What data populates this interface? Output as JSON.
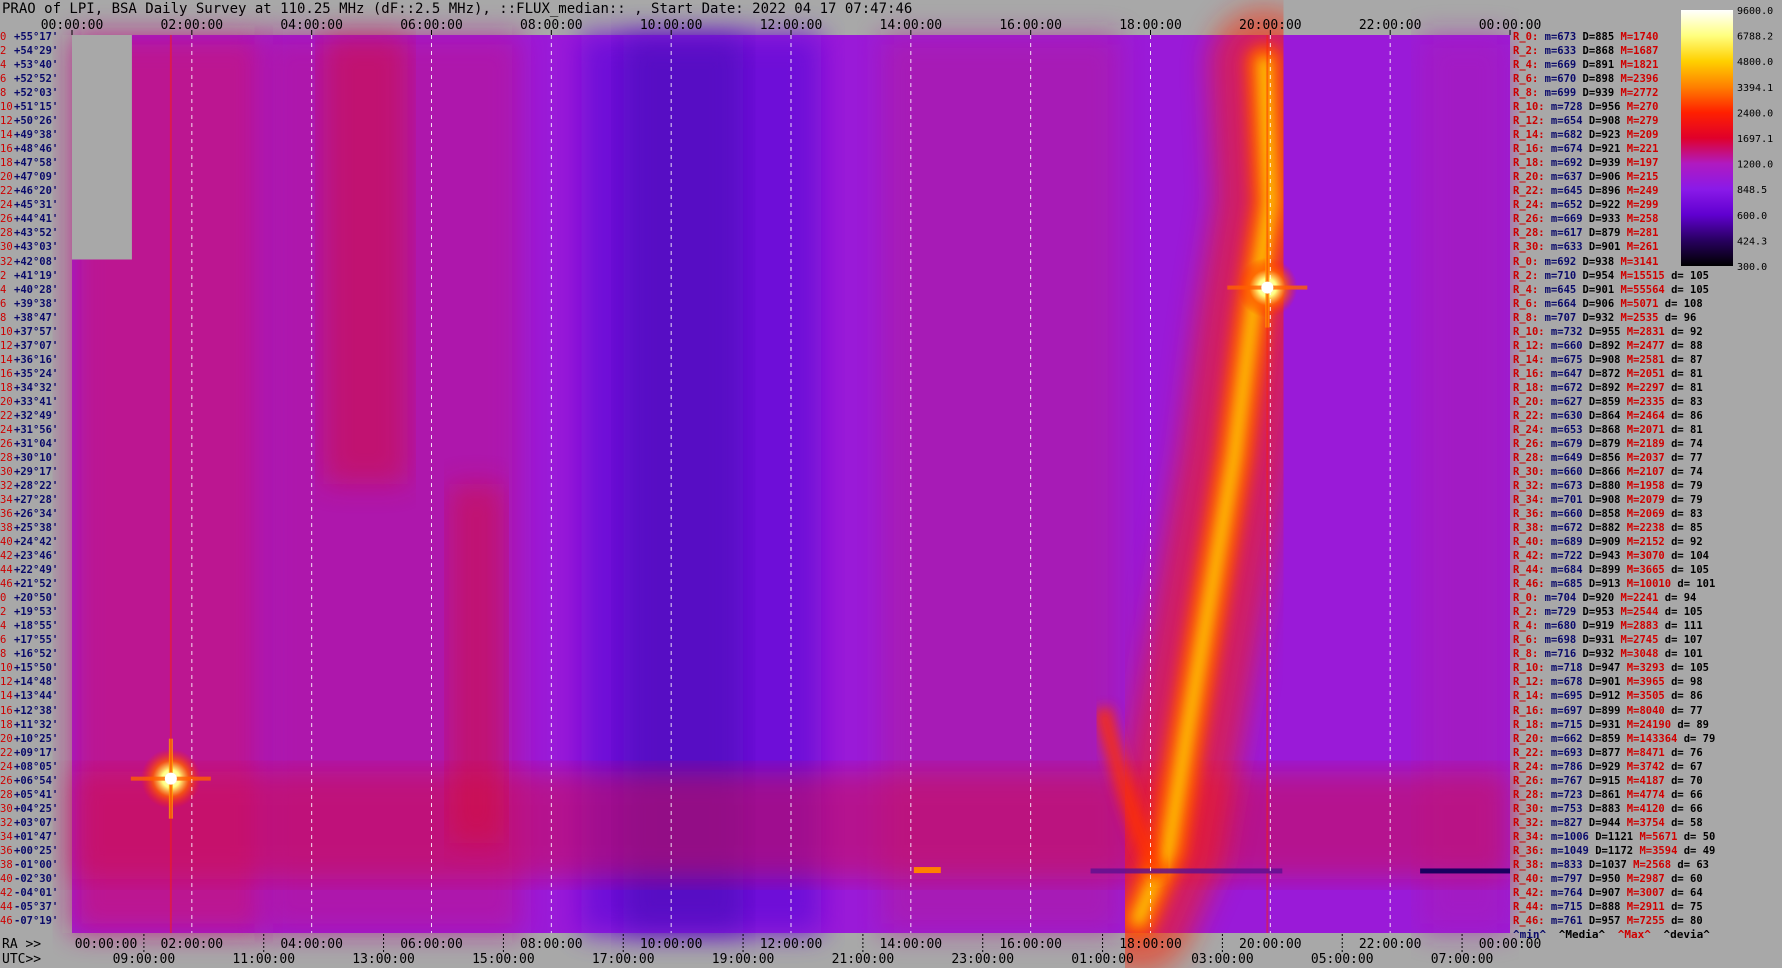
{
  "title": "PRAO of LPI, BSA Daily Survey at 110.25 MHz (dF::2.5 MHz), ::FLUX_median:: , Start Date: 2022 04 17 07:47:46",
  "chart_data": {
    "type": "heatmap",
    "title": "PRAO of LPI, BSA Daily Survey at 110.25 MHz (dF::2.5 MHz), ::FLUX_median:: , Start Date: 2022 04 17 07:47:46",
    "top_time_ticks": [
      "00:00:00",
      "02:00:00",
      "04:00:00",
      "06:00:00",
      "08:00:00",
      "10:00:00",
      "12:00:00",
      "14:00:00",
      "16:00:00",
      "18:00:00",
      "20:00:00",
      "22:00:00",
      "00:00:00"
    ],
    "ra_prefix": "RA >>",
    "ra_ticks": [
      "00:00:00",
      "02:00:00",
      "04:00:00",
      "06:00:00",
      "08:00:00",
      "10:00:00",
      "12:00:00",
      "14:00:00",
      "16:00:00",
      "18:00:00",
      "20:00:00",
      "22:00:00",
      "00:00:00"
    ],
    "utc_prefix": "UTC>>",
    "utc_ticks": [
      "09:00:00",
      "11:00:00",
      "13:00:00",
      "15:00:00",
      "17:00:00",
      "19:00:00",
      "21:00:00",
      "23:00:00",
      "01:00:00",
      "03:00:00",
      "05:00:00",
      "07:00:00"
    ],
    "colorbar": {
      "labels": [
        "9600.0",
        "6788.2",
        "4800.0",
        "3394.1",
        "2400.0",
        "1697.1",
        "1200.0",
        "848.5",
        "600.0",
        "424.3",
        "300.0"
      ],
      "colors": [
        "#ffffff",
        "#ffff80",
        "#ffd000",
        "#ff8000",
        "#ff2000",
        "#e0002a",
        "#b01ac0",
        "#8a1ae8",
        "#6000d0",
        "#280060",
        "#000000"
      ]
    },
    "declinations": [
      {
        "idx": "0",
        "dec": "+55°17'"
      },
      {
        "idx": "2",
        "dec": "+54°29'"
      },
      {
        "idx": "4",
        "dec": "+53°40'"
      },
      {
        "idx": "6",
        "dec": "+52°52'"
      },
      {
        "idx": "8",
        "dec": "+52°03'"
      },
      {
        "idx": "10",
        "dec": "+51°15'"
      },
      {
        "idx": "12",
        "dec": "+50°26'"
      },
      {
        "idx": "14",
        "dec": "+49°38'"
      },
      {
        "idx": "16",
        "dec": "+48°46'"
      },
      {
        "idx": "18",
        "dec": "+47°58'"
      },
      {
        "idx": "20",
        "dec": "+47°09'"
      },
      {
        "idx": "22",
        "dec": "+46°20'"
      },
      {
        "idx": "24",
        "dec": "+45°31'"
      },
      {
        "idx": "26",
        "dec": "+44°41'"
      },
      {
        "idx": "28",
        "dec": "+43°52'"
      },
      {
        "idx": "30",
        "dec": "+43°03'"
      },
      {
        "idx": "32",
        "dec": "+42°08'"
      },
      {
        "idx": "2",
        "dec": "+41°19'"
      },
      {
        "idx": "4",
        "dec": "+40°28'"
      },
      {
        "idx": "6",
        "dec": "+39°38'"
      },
      {
        "idx": "8",
        "dec": "+38°47'"
      },
      {
        "idx": "10",
        "dec": "+37°57'"
      },
      {
        "idx": "12",
        "dec": "+37°07'"
      },
      {
        "idx": "14",
        "dec": "+36°16'"
      },
      {
        "idx": "16",
        "dec": "+35°24'"
      },
      {
        "idx": "18",
        "dec": "+34°32'"
      },
      {
        "idx": "20",
        "dec": "+33°41'"
      },
      {
        "idx": "22",
        "dec": "+32°49'"
      },
      {
        "idx": "24",
        "dec": "+31°56'"
      },
      {
        "idx": "26",
        "dec": "+31°04'"
      },
      {
        "idx": "28",
        "dec": "+30°10'"
      },
      {
        "idx": "30",
        "dec": "+29°17'"
      },
      {
        "idx": "32",
        "dec": "+28°22'"
      },
      {
        "idx": "34",
        "dec": "+27°28'"
      },
      {
        "idx": "36",
        "dec": "+26°34'"
      },
      {
        "idx": "38",
        "dec": "+25°38'"
      },
      {
        "idx": "40",
        "dec": "+24°42'"
      },
      {
        "idx": "42",
        "dec": "+23°46'"
      },
      {
        "idx": "44",
        "dec": "+22°49'"
      },
      {
        "idx": "46",
        "dec": "+21°52'"
      },
      {
        "idx": "0",
        "dec": "+20°50'"
      },
      {
        "idx": "2",
        "dec": "+19°53'"
      },
      {
        "idx": "4",
        "dec": "+18°55'"
      },
      {
        "idx": "6",
        "dec": "+17°55'"
      },
      {
        "idx": "8",
        "dec": "+16°52'"
      },
      {
        "idx": "10",
        "dec": "+15°50'"
      },
      {
        "idx": "12",
        "dec": "+14°48'"
      },
      {
        "idx": "14",
        "dec": "+13°44'"
      },
      {
        "idx": "16",
        "dec": "+12°38'"
      },
      {
        "idx": "18",
        "dec": "+11°32'"
      },
      {
        "idx": "20",
        "dec": "+10°25'"
      },
      {
        "idx": "22",
        "dec": "+09°17'"
      },
      {
        "idx": "24",
        "dec": "+08°05'"
      },
      {
        "idx": "26",
        "dec": "+06°54'"
      },
      {
        "idx": "28",
        "dec": "+05°41'"
      },
      {
        "idx": "30",
        "dec": "+04°25'"
      },
      {
        "idx": "32",
        "dec": "+03°07'"
      },
      {
        "idx": "34",
        "dec": "+01°47'"
      },
      {
        "idx": "36",
        "dec": "+00°25'"
      },
      {
        "idx": "38",
        "dec": "-01°00'"
      },
      {
        "idx": "40",
        "dec": "-02°30'"
      },
      {
        "idx": "42",
        "dec": "-04°01'"
      },
      {
        "idx": "44",
        "dec": "-05°37'"
      },
      {
        "idx": "46",
        "dec": "-07°19'"
      }
    ],
    "beam_stats": [
      {
        "beam": "R_0:",
        "min": "673",
        "median": "885",
        "max": "1740",
        "dev": ""
      },
      {
        "beam": "R_2:",
        "min": "633",
        "median": "868",
        "max": "1687",
        "dev": ""
      },
      {
        "beam": "R_4:",
        "min": "669",
        "median": "891",
        "max": "1821",
        "dev": ""
      },
      {
        "beam": "R_6:",
        "min": "670",
        "median": "898",
        "max": "2396",
        "dev": ""
      },
      {
        "beam": "R_8:",
        "min": "699",
        "median": "939",
        "max": "2772",
        "dev": ""
      },
      {
        "beam": "R_10:",
        "min": "728",
        "median": "956",
        "max": "270",
        "dev": ""
      },
      {
        "beam": "R_12:",
        "min": "654",
        "median": "908",
        "max": "279",
        "dev": ""
      },
      {
        "beam": "R_14:",
        "min": "682",
        "median": "923",
        "max": "209",
        "dev": ""
      },
      {
        "beam": "R_16:",
        "min": "674",
        "median": "921",
        "max": "221",
        "dev": ""
      },
      {
        "beam": "R_18:",
        "min": "692",
        "median": "939",
        "max": "197",
        "dev": ""
      },
      {
        "beam": "R_20:",
        "min": "637",
        "median": "906",
        "max": "215",
        "dev": ""
      },
      {
        "beam": "R_22:",
        "min": "645",
        "median": "896",
        "max": "249",
        "dev": ""
      },
      {
        "beam": "R_24:",
        "min": "652",
        "median": "922",
        "max": "299",
        "dev": ""
      },
      {
        "beam": "R_26:",
        "min": "669",
        "median": "933",
        "max": "258",
        "dev": ""
      },
      {
        "beam": "R_28:",
        "min": "617",
        "median": "879",
        "max": "281",
        "dev": ""
      },
      {
        "beam": "R_30:",
        "min": "633",
        "median": "901",
        "max": "261",
        "dev": ""
      },
      {
        "beam": "R_0:",
        "min": "692",
        "median": "938",
        "max": "3141",
        "dev": ""
      },
      {
        "beam": "R_2:",
        "min": "710",
        "median": "954",
        "max": "15515",
        "dev": "105"
      },
      {
        "beam": "R_4:",
        "min": "645",
        "median": "901",
        "max": "55564",
        "dev": "105"
      },
      {
        "beam": "R_6:",
        "min": "664",
        "median": "906",
        "max": "5071",
        "dev": "108"
      },
      {
        "beam": "R_8:",
        "min": "707",
        "median": "932",
        "max": "2535",
        "dev": "96"
      },
      {
        "beam": "R_10:",
        "min": "732",
        "median": "955",
        "max": "2831",
        "dev": "92"
      },
      {
        "beam": "R_12:",
        "min": "660",
        "median": "892",
        "max": "2477",
        "dev": "88"
      },
      {
        "beam": "R_14:",
        "min": "675",
        "median": "908",
        "max": "2581",
        "dev": "87"
      },
      {
        "beam": "R_16:",
        "min": "647",
        "median": "872",
        "max": "2051",
        "dev": "81"
      },
      {
        "beam": "R_18:",
        "min": "672",
        "median": "892",
        "max": "2297",
        "dev": "81"
      },
      {
        "beam": "R_20:",
        "min": "627",
        "median": "859",
        "max": "2335",
        "dev": "83"
      },
      {
        "beam": "R_22:",
        "min": "630",
        "median": "864",
        "max": "2464",
        "dev": "86"
      },
      {
        "beam": "R_24:",
        "min": "653",
        "median": "868",
        "max": "2071",
        "dev": "81"
      },
      {
        "beam": "R_26:",
        "min": "679",
        "median": "879",
        "max": "2189",
        "dev": "74"
      },
      {
        "beam": "R_28:",
        "min": "649",
        "median": "856",
        "max": "2037",
        "dev": "77"
      },
      {
        "beam": "R_30:",
        "min": "660",
        "median": "866",
        "max": "2107",
        "dev": "74"
      },
      {
        "beam": "R_32:",
        "min": "673",
        "median": "880",
        "max": "1958",
        "dev": "79"
      },
      {
        "beam": "R_34:",
        "min": "701",
        "median": "908",
        "max": "2079",
        "dev": "79"
      },
      {
        "beam": "R_36:",
        "min": "660",
        "median": "858",
        "max": "2069",
        "dev": "83"
      },
      {
        "beam": "R_38:",
        "min": "672",
        "median": "882",
        "max": "2238",
        "dev": "85"
      },
      {
        "beam": "R_40:",
        "min": "689",
        "median": "909",
        "max": "2152",
        "dev": "92"
      },
      {
        "beam": "R_42:",
        "min": "722",
        "median": "943",
        "max": "3070",
        "dev": "104"
      },
      {
        "beam": "R_44:",
        "min": "684",
        "median": "899",
        "max": "3665",
        "dev": "105"
      },
      {
        "beam": "R_46:",
        "min": "685",
        "median": "913",
        "max": "10010",
        "dev": "101"
      },
      {
        "beam": "R_0:",
        "min": "704",
        "median": "920",
        "max": "2241",
        "dev": "94"
      },
      {
        "beam": "R_2:",
        "min": "729",
        "median": "953",
        "max": "2544",
        "dev": "105"
      },
      {
        "beam": "R_4:",
        "min": "680",
        "median": "919",
        "max": "2883",
        "dev": "111"
      },
      {
        "beam": "R_6:",
        "min": "698",
        "median": "931",
        "max": "2745",
        "dev": "107"
      },
      {
        "beam": "R_8:",
        "min": "716",
        "median": "932",
        "max": "3048",
        "dev": "101"
      },
      {
        "beam": "R_10:",
        "min": "718",
        "median": "947",
        "max": "3293",
        "dev": "105"
      },
      {
        "beam": "R_12:",
        "min": "678",
        "median": "901",
        "max": "3965",
        "dev": "98"
      },
      {
        "beam": "R_14:",
        "min": "695",
        "median": "912",
        "max": "3505",
        "dev": "86"
      },
      {
        "beam": "R_16:",
        "min": "697",
        "median": "899",
        "max": "8040",
        "dev": "77"
      },
      {
        "beam": "R_18:",
        "min": "715",
        "median": "931",
        "max": "24190",
        "dev": "89"
      },
      {
        "beam": "R_20:",
        "min": "662",
        "median": "859",
        "max": "143364",
        "dev": "79"
      },
      {
        "beam": "R_22:",
        "min": "693",
        "median": "877",
        "max": "8471",
        "dev": "76"
      },
      {
        "beam": "R_24:",
        "min": "786",
        "median": "929",
        "max": "3742",
        "dev": "67"
      },
      {
        "beam": "R_26:",
        "min": "767",
        "median": "915",
        "max": "4187",
        "dev": "70"
      },
      {
        "beam": "R_28:",
        "min": "723",
        "median": "861",
        "max": "4774",
        "dev": "66"
      },
      {
        "beam": "R_30:",
        "min": "753",
        "median": "883",
        "max": "4120",
        "dev": "66"
      },
      {
        "beam": "R_32:",
        "min": "827",
        "median": "944",
        "max": "3754",
        "dev": "58"
      },
      {
        "beam": "R_34:",
        "min": "1006",
        "median": "1121",
        "max": "5671",
        "dev": "50"
      },
      {
        "beam": "R_36:",
        "min": "1049",
        "median": "1172",
        "max": "3594",
        "dev": "49"
      },
      {
        "beam": "R_38:",
        "min": "833",
        "median": "1037",
        "max": "2568",
        "dev": "63"
      },
      {
        "beam": "R_40:",
        "min": "797",
        "median": "950",
        "max": "2987",
        "dev": "60"
      },
      {
        "beam": "R_42:",
        "min": "764",
        "median": "907",
        "max": "3007",
        "dev": "64"
      },
      {
        "beam": "R_44:",
        "min": "715",
        "median": "888",
        "max": "2911",
        "dev": "75"
      },
      {
        "beam": "R_46:",
        "min": "761",
        "median": "957",
        "max": "7255",
        "dev": "80"
      }
    ],
    "stat_prefixes": {
      "min": "m=",
      "median": "D=",
      "max": "M=",
      "dev": "d="
    },
    "legend_footer": {
      "min": "^min^",
      "median": "^Media^",
      "max": "^Max^",
      "dev": "^devia^"
    },
    "features": [
      {
        "name": "bright source",
        "ra_hours": 1.65,
        "dec_row": 53,
        "peak": "white"
      },
      {
        "name": "bright source",
        "ra_hours": 19.95,
        "dec_row": 18,
        "peak": "white"
      },
      {
        "name": "milky way band",
        "ra_hours_range": [
          17.5,
          22.0
        ],
        "peak": "yellow"
      }
    ]
  }
}
